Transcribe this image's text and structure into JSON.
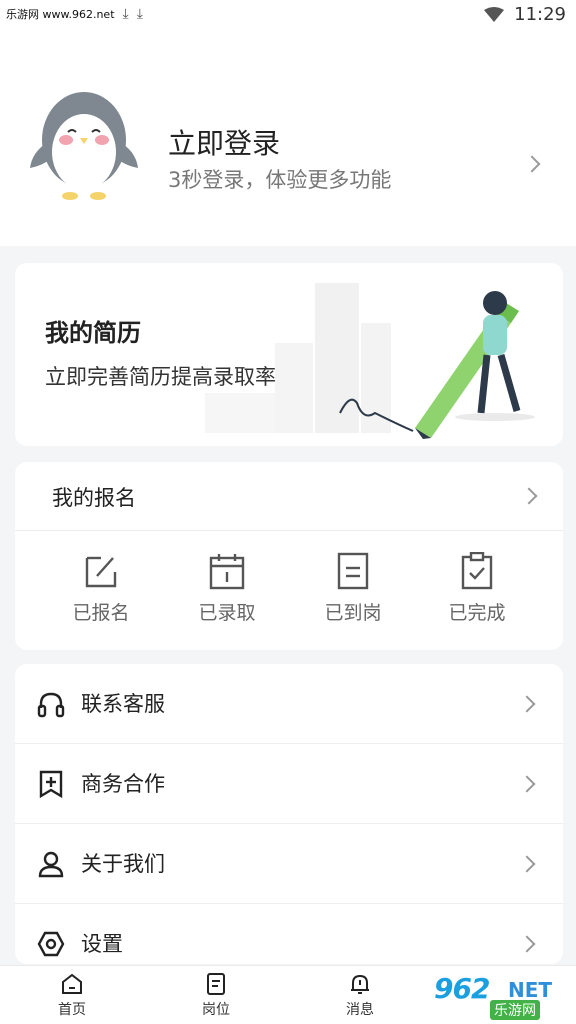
{
  "status_bar": {
    "site": "乐游网 www.962.net",
    "time": "11:29"
  },
  "profile": {
    "title": "立即登录",
    "subtitle": "3秒登录，体验更多功能"
  },
  "resume": {
    "title": "我的简历",
    "subtitle": "立即完善简历提高录取率"
  },
  "signup": {
    "title": "我的报名",
    "items": [
      {
        "label": "已报名",
        "icon": "edit-icon"
      },
      {
        "label": "已录取",
        "icon": "calendar-icon"
      },
      {
        "label": "已到岗",
        "icon": "document-icon"
      },
      {
        "label": "已完成",
        "icon": "clipboard-check-icon"
      }
    ]
  },
  "menu": [
    {
      "label": "联系客服",
      "icon": "headset-icon"
    },
    {
      "label": "商务合作",
      "icon": "bookmark-plus-icon"
    },
    {
      "label": "关于我们",
      "icon": "user-icon"
    },
    {
      "label": "设置",
      "icon": "settings-icon"
    }
  ],
  "tabs": [
    {
      "label": "首页",
      "icon": "home-icon"
    },
    {
      "label": "岗位",
      "icon": "list-icon"
    },
    {
      "label": "消息",
      "icon": "bell-icon"
    }
  ],
  "watermark": {
    "number": "962",
    "net": "NET",
    "sub": "乐游网"
  },
  "colors": {
    "accent_green": "#7fd06a",
    "watermark_blue": "#1a9fe0",
    "background": "#f4f5f7"
  }
}
